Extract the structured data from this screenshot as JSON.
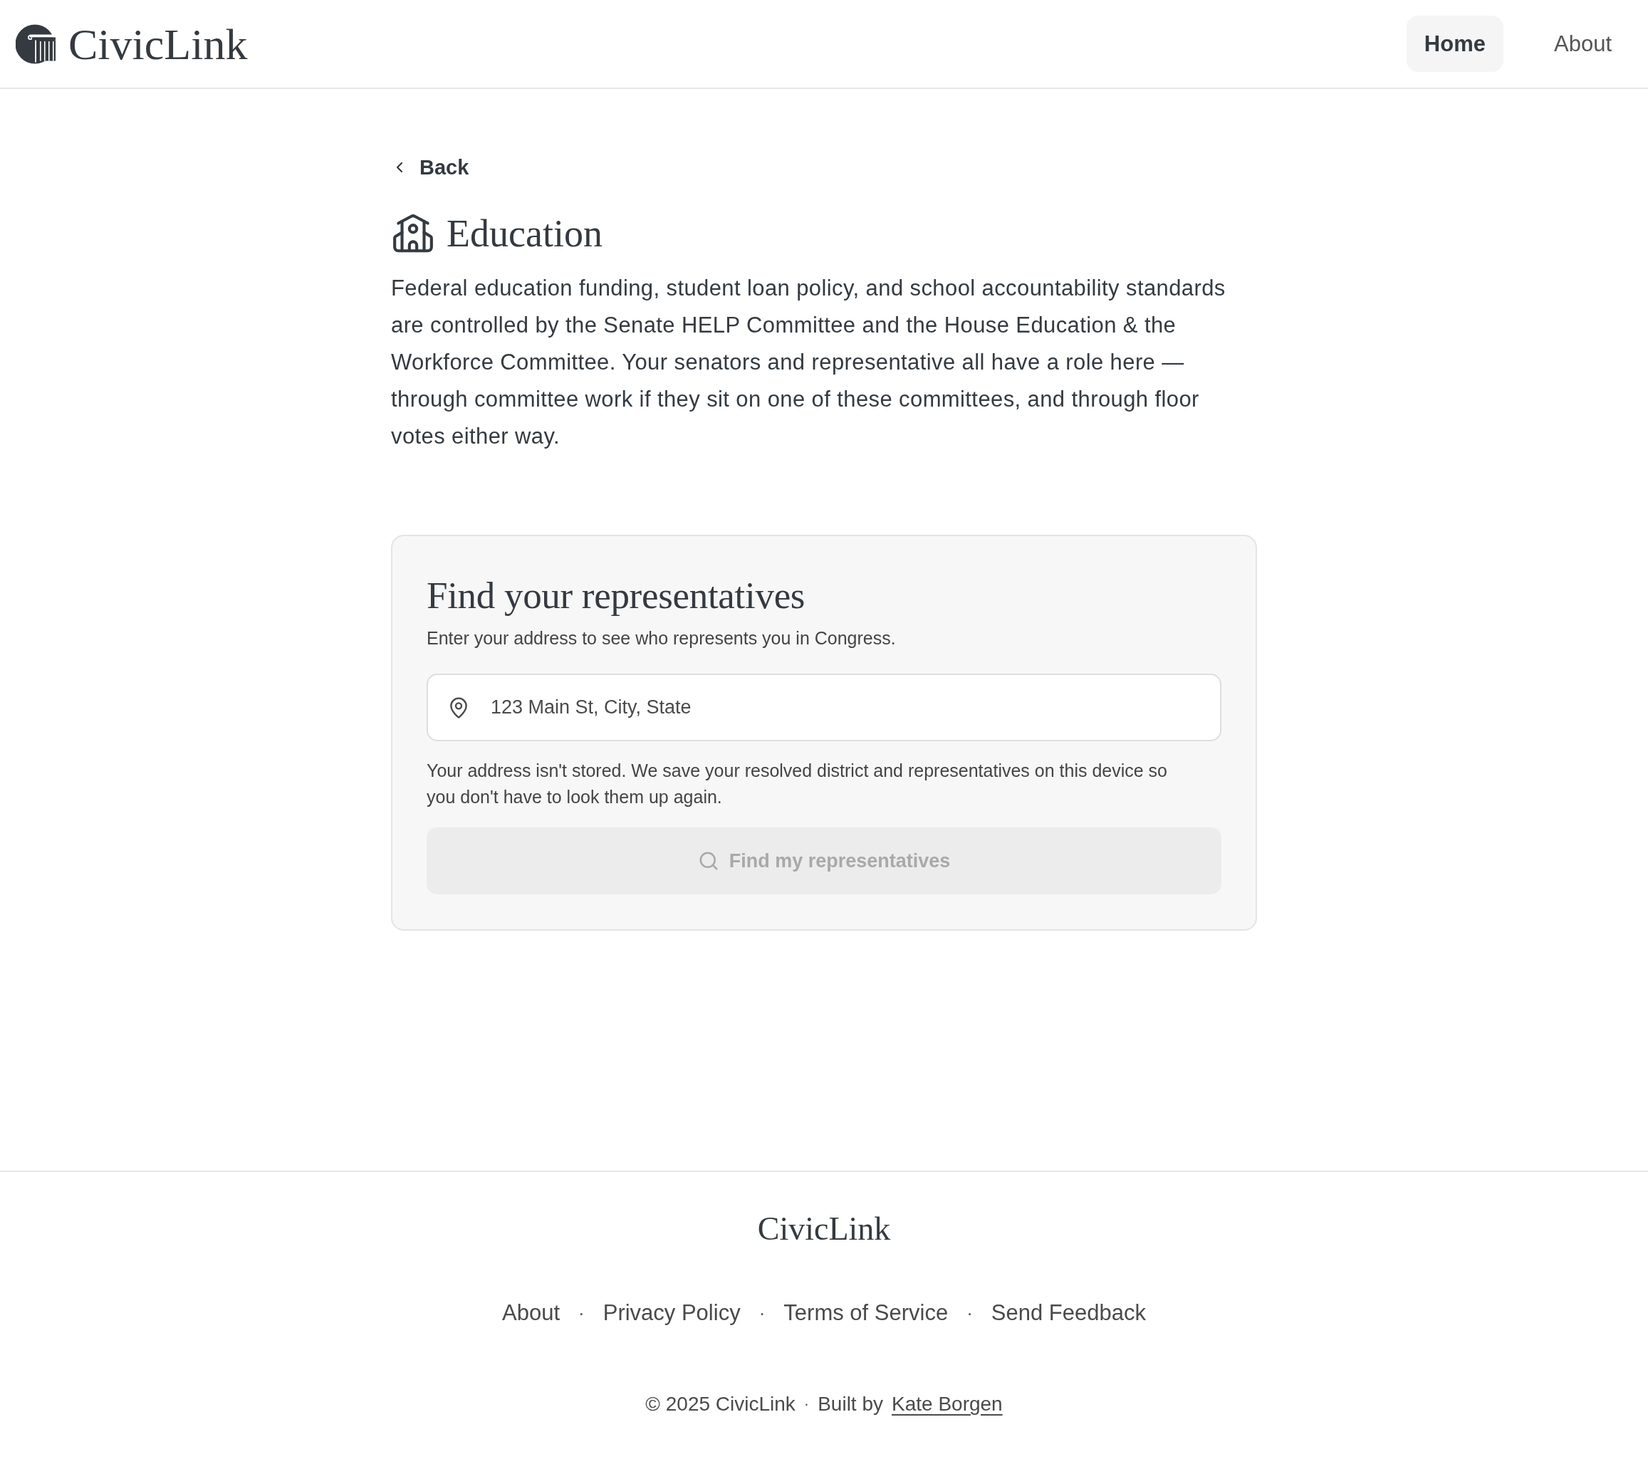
{
  "header": {
    "logo": "CivicLink",
    "nav": [
      {
        "label": "Home",
        "selected": true
      },
      {
        "label": "About",
        "selected": false
      }
    ]
  },
  "back_link": {
    "label": "Back"
  },
  "topic": {
    "title": "Education",
    "description": "Federal education funding, student loan policy, and school accountability standards are controlled by the Senate HELP Committee and the House Education & the Workforce Committee. Your senators and representative all have a role here — through committee work if they sit on one of these committees, and through floor votes either way."
  },
  "finder": {
    "title": "Find your representatives",
    "subtitle": "Enter your address to see who represents you in Congress.",
    "address_field": {
      "placeholder": "123 Main St, City, State"
    },
    "privacy_note": "Your address isn't stored. We save your resolved district and representatives on this device so you don't have to look them up again.",
    "submit_button": {
      "label": "Find my representatives",
      "disabled": true
    }
  },
  "footer": {
    "logo": "CivicLink",
    "links": [
      "About",
      "Privacy Policy",
      "Terms of Service",
      "Send Feedback"
    ],
    "link_separators": [
      "·",
      "·",
      "·"
    ],
    "copyright": "© 2025 CivicLink",
    "credit_separator": "·",
    "credit": "Built by",
    "author_link": "Kate Borgen"
  }
}
